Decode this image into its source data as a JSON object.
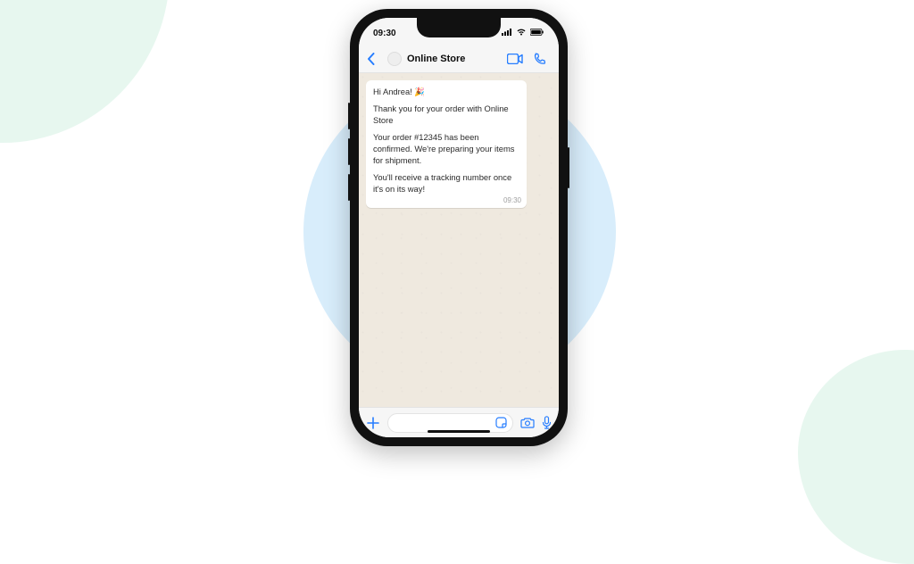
{
  "status": {
    "time": "09:30"
  },
  "header": {
    "contact_name": "Online Store"
  },
  "message": {
    "line1": "Hi Andrea! 🎉",
    "line2": "Thank you for your order with Online Store",
    "line3": "Your order #12345 has been confirmed. We're preparing your items for shipment.",
    "line4": "You'll receive a tracking number once it's on its way!",
    "time": "09:30"
  }
}
